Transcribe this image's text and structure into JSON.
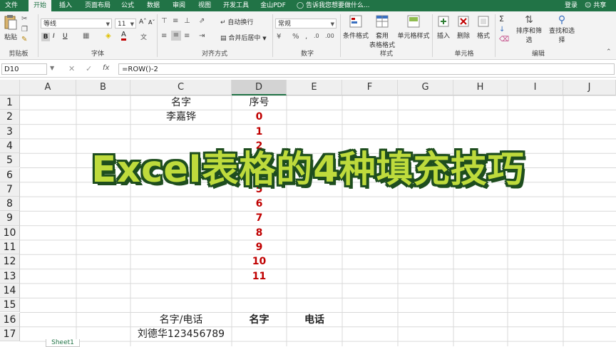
{
  "tabs": [
    "文件",
    "开始",
    "插入",
    "页面布局",
    "公式",
    "数据",
    "审阅",
    "视图",
    "开发工具",
    "金山PDF"
  ],
  "tell_me": "告诉我您想要做什么...",
  "login": "登录",
  "share": "共享",
  "ribbon": {
    "clipboard": {
      "paste": "粘贴",
      "label": "剪贴板"
    },
    "font": {
      "name": "等线",
      "size": "11",
      "label": "字体"
    },
    "align": {
      "wrap": "自动换行",
      "merge": "合并后居中",
      "label": "对齐方式"
    },
    "number": {
      "format": "常规",
      "label": "数字"
    },
    "styles": {
      "cond": "条件格式",
      "table": "套用",
      "table2": "表格格式",
      "cell": "单元格样式",
      "label": "样式"
    },
    "cells": {
      "insert": "插入",
      "delete": "删除",
      "format": "格式",
      "label": "单元格"
    },
    "edit": {
      "sort": "排序和筛选",
      "find": "查找和选择",
      "label": "编辑"
    }
  },
  "formula_bar": {
    "cell_ref": "D10",
    "fx": "fx",
    "formula": "=ROW()-2"
  },
  "columns": [
    "A",
    "B",
    "C",
    "D",
    "E",
    "F",
    "G",
    "H",
    "I",
    "J"
  ],
  "rows": [
    "1",
    "2",
    "3",
    "4",
    "5",
    "6",
    "7",
    "8",
    "9",
    "10",
    "11",
    "12",
    "13",
    "14",
    "15",
    "16",
    "17"
  ],
  "cells": {
    "C1": "名字",
    "D1": "序号",
    "C2": "李嘉铧",
    "D2": "0",
    "D3": "1",
    "D4": "2",
    "D5": "3",
    "D6": "4",
    "D7": "5",
    "D8": "6",
    "D9": "7",
    "D10": "8",
    "D11": "9",
    "D12": "10",
    "D13": "11",
    "C16": "名字/电话",
    "D16": "名字",
    "E16": "电话",
    "C17": "刘德华123456789"
  },
  "overlay_title": "Excel表格的4种填充技巧",
  "sheet_tab": "Sheet1",
  "colors": {
    "excel_green": "#217346",
    "red_text": "#c00000",
    "overlay_fill": "#bedb3c",
    "overlay_outline": "#1e4d1e"
  }
}
